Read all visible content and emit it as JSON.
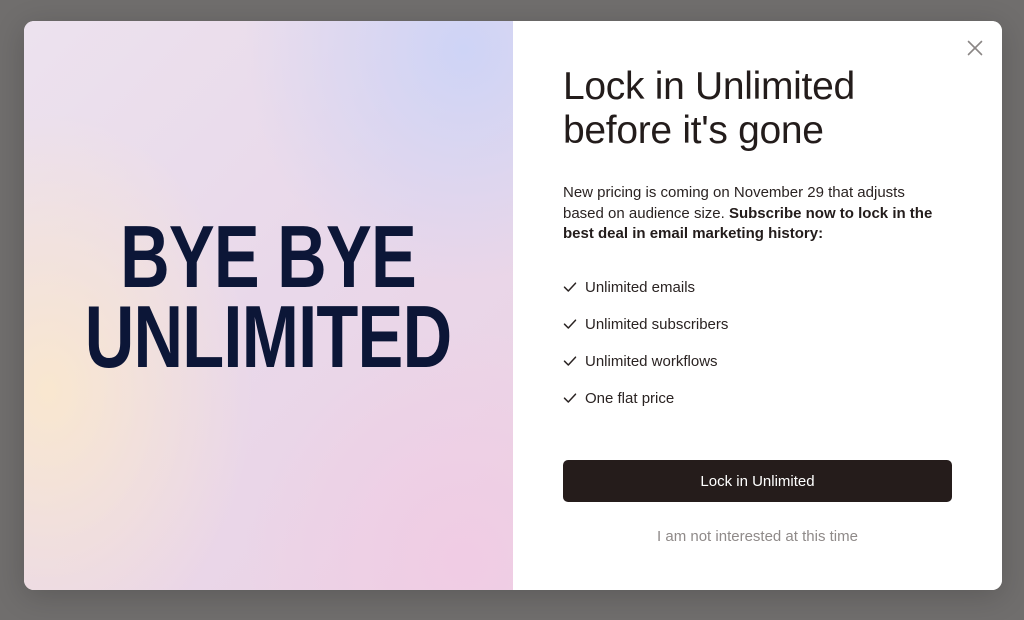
{
  "hero": {
    "line1": "BYE BYE",
    "line2": "UNLIMITED"
  },
  "panel": {
    "headline": "Lock in Unlimited before it's gone",
    "intro_regular": "New pricing is coming on November 29 that adjusts based on audience size. ",
    "intro_bold": "Subscribe now to lock in the best deal in email marketing history:",
    "features": [
      "Unlimited emails",
      "Unlimited subscribers",
      "Unlimited workflows",
      "One flat price"
    ],
    "cta_label": "Lock in Unlimited",
    "decline_label": "I am not interested at this time"
  },
  "icons": {
    "close": "close-icon",
    "check": "check-icon"
  },
  "colors": {
    "overlay": "#706e6d",
    "hero_text": "#0c1637",
    "button_bg": "#251c1b",
    "button_text": "#ffffff",
    "muted_text": "#8f8a89"
  }
}
